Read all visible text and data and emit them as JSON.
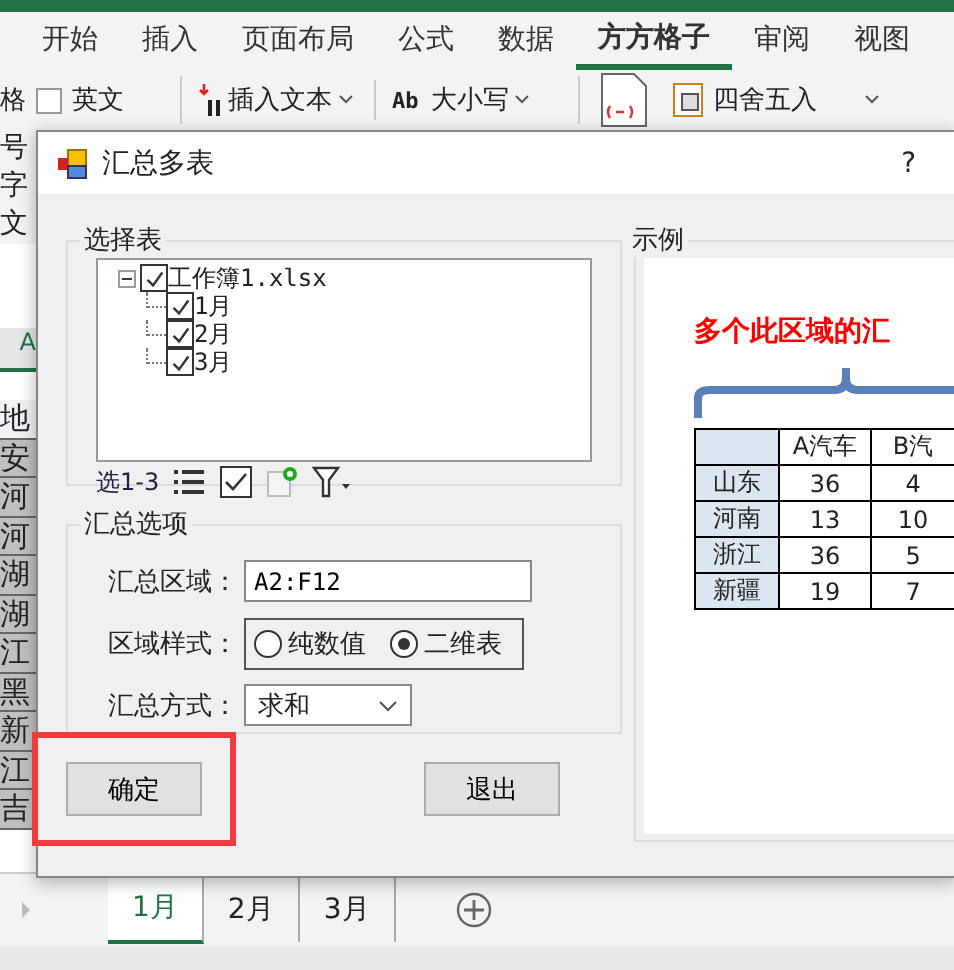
{
  "ribbon_tabs": [
    {
      "label": "开始",
      "selected": false
    },
    {
      "label": "插入",
      "selected": false
    },
    {
      "label": "页面布局",
      "selected": false
    },
    {
      "label": "公式",
      "selected": false
    },
    {
      "label": "数据",
      "selected": false
    },
    {
      "label": "方方格子",
      "selected": true
    },
    {
      "label": "审阅",
      "selected": false
    },
    {
      "label": "视图",
      "selected": false
    }
  ],
  "ribbon": {
    "partial_label": "格",
    "english_checkbox": {
      "label": "英文",
      "checked": false
    },
    "insert_text": "插入文本",
    "case_icon": "Ab",
    "case": "大小写",
    "round": "四舍五入"
  },
  "sheet": {
    "side_labels": [
      "号",
      "字",
      "文"
    ],
    "column_header": "A",
    "cells": [
      "地",
      "安",
      "河",
      "河",
      "湖",
      "湖",
      "江",
      "黑",
      "新",
      "江",
      "吉"
    ]
  },
  "dialog": {
    "title": "汇总多表",
    "help": "?",
    "select_group": {
      "title": "选择表",
      "tree": {
        "label": "工作簿1.xlsx",
        "checked": true,
        "expanded": true,
        "children": [
          {
            "label": "1月",
            "checked": true
          },
          {
            "label": "2月",
            "checked": true
          },
          {
            "label": "3月",
            "checked": true
          }
        ]
      },
      "toolbar_label": "选1-3"
    },
    "options_group": {
      "title": "汇总选项",
      "range": {
        "label": "汇总区域：",
        "value": "A2:F12"
      },
      "style": {
        "label": "区域样式：",
        "options": [
          {
            "label": "纯数值",
            "selected": false
          },
          {
            "label": "二维表",
            "selected": true
          }
        ]
      },
      "method": {
        "label": "汇总方式：",
        "value": "求和"
      }
    },
    "example": {
      "title": "示例",
      "caption": "多个此区域的汇",
      "table": {
        "columns": [
          "A汽车",
          "B汽"
        ],
        "rows": [
          {
            "name": "山东",
            "values": [
              "36",
              "4"
            ]
          },
          {
            "name": "河南",
            "values": [
              "13",
              "10"
            ]
          },
          {
            "name": "浙江",
            "values": [
              "36",
              "5"
            ]
          },
          {
            "name": "新疆",
            "values": [
              "19",
              "7"
            ]
          }
        ]
      }
    },
    "buttons": [
      {
        "label": "确定",
        "highlighted": true
      },
      {
        "label": "退出",
        "highlighted": false
      }
    ]
  },
  "sheet_tabs": [
    {
      "label": "1月",
      "selected": true
    },
    {
      "label": "2月",
      "selected": false
    },
    {
      "label": "3月",
      "selected": false
    }
  ]
}
